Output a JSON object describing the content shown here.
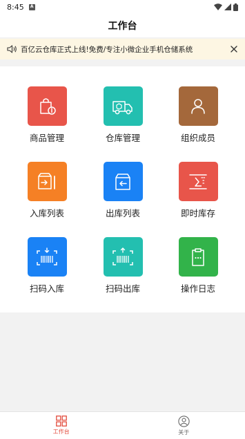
{
  "status_bar": {
    "time": "8:45",
    "sim_letter": "A"
  },
  "header": {
    "title": "工作台"
  },
  "notice": {
    "text": "百亿云仓库正式上线!免费/专注小微企业手机仓储系统"
  },
  "tiles": [
    {
      "label": "商品管理",
      "icon": "shopping-bag-icon",
      "color": "#e8554a"
    },
    {
      "label": "仓库管理",
      "icon": "delivery-truck-icon",
      "color": "#23bfb0"
    },
    {
      "label": "组织成员",
      "icon": "user-icon",
      "color": "#a4683b"
    },
    {
      "label": "入库列表",
      "icon": "inbound-box-icon",
      "color": "#f58025"
    },
    {
      "label": "出库列表",
      "icon": "outbound-box-icon",
      "color": "#1a82f5"
    },
    {
      "label": "即时库存",
      "icon": "sum-icon",
      "color": "#e8554a"
    },
    {
      "label": "扫码入库",
      "icon": "scan-in-icon",
      "color": "#1a82f5"
    },
    {
      "label": "扫码出库",
      "icon": "scan-out-icon",
      "color": "#23bfb0"
    },
    {
      "label": "操作日志",
      "icon": "clipboard-icon",
      "color": "#32b34a"
    }
  ],
  "tabbar": {
    "items": [
      {
        "label": "工作台",
        "icon": "grid-icon",
        "active": true
      },
      {
        "label": "关于",
        "icon": "profile-icon",
        "active": false
      }
    ],
    "active_color": "#e24a3b"
  }
}
